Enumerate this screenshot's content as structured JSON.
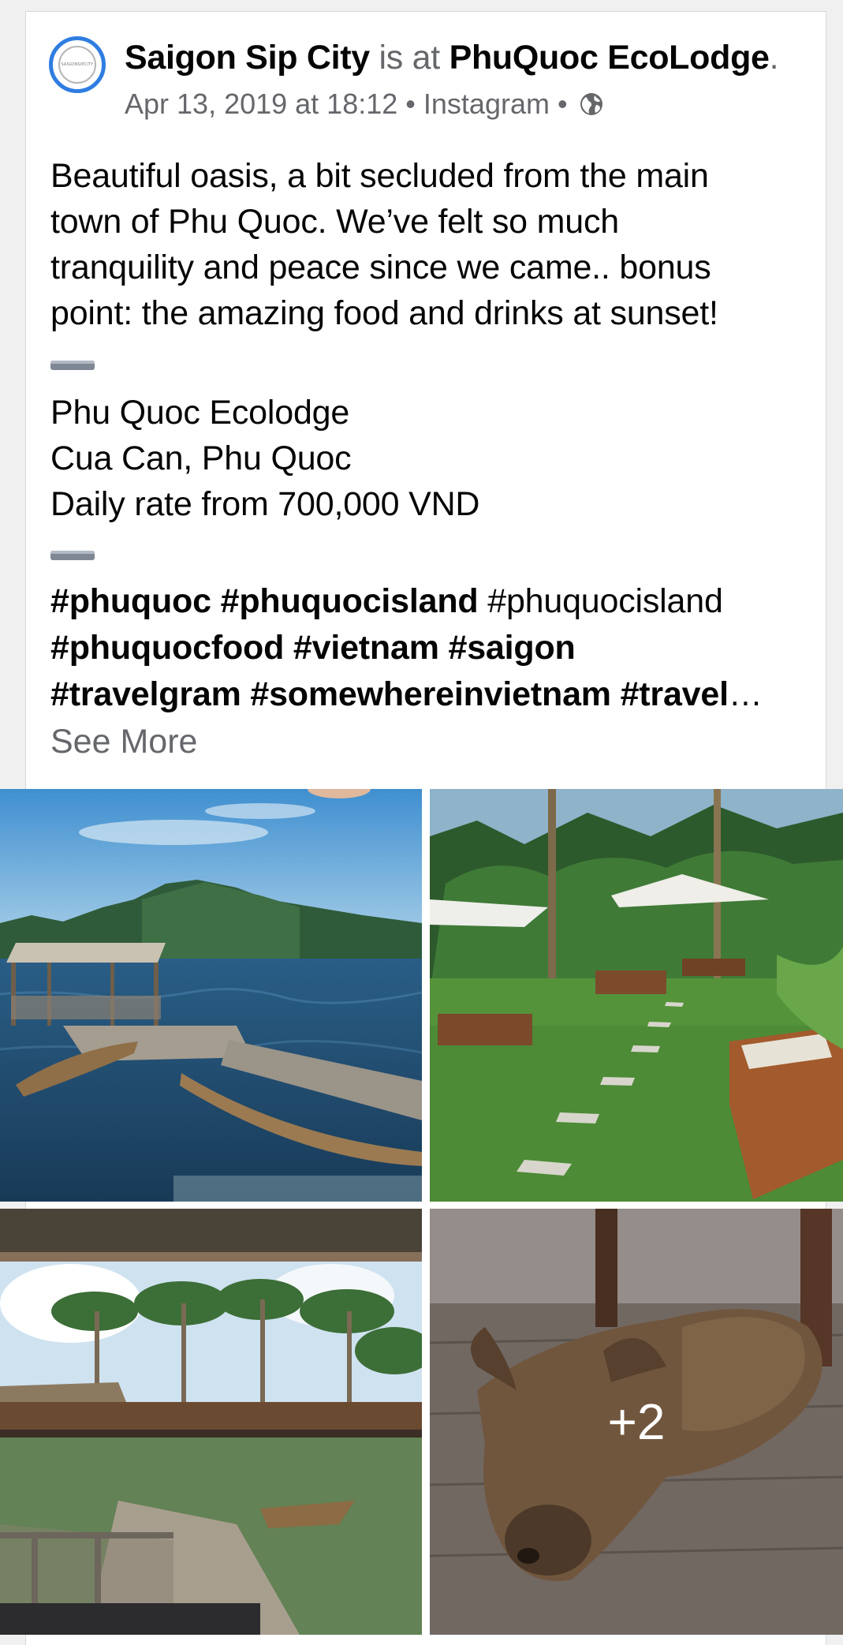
{
  "post": {
    "author": "Saigon Sip City",
    "connector": "is at",
    "place": "PhuQuoc EcoLodge",
    "period": ".",
    "timestamp": "Apr 13, 2019 at 18:12",
    "source": "Instagram",
    "separator": "•",
    "privacy_icon": "globe-icon",
    "avatar_text": "SAIGONSIPCITY",
    "description_lines": [
      "Beautiful oasis, a bit secluded from the main",
      "town of Phu Quoc. We’ve felt so much",
      "tranquility and peace since we came.. bonus",
      "point: the amazing food and drinks at sunset!"
    ],
    "address_lines": [
      "Phu Quoc Ecolodge",
      "Cua Can, Phu Quoc",
      "Daily rate from 700,000 VND"
    ],
    "hashtags": {
      "line1": {
        "a": "#",
        "b": "phuquoc",
        "c": " #",
        "d": "phuquocisland",
        "e": " #phuquocisland"
      },
      "line2": {
        "a": "#",
        "b": "phuquocfood",
        "c": " #",
        "d": "vietnam",
        "e": " #",
        "f": "saigon"
      },
      "line3": {
        "a": "#",
        "b": "travelgram",
        "c": " #",
        "d": "somewhereinvietnam",
        "e": " #",
        "f": "travel",
        "g": "…"
      }
    },
    "see_more": "See More",
    "more_photos": "+2"
  },
  "colors": {
    "avatar_ring": "#2f7de1",
    "secondary_text": "#65676b",
    "primary_text": "#050505"
  }
}
